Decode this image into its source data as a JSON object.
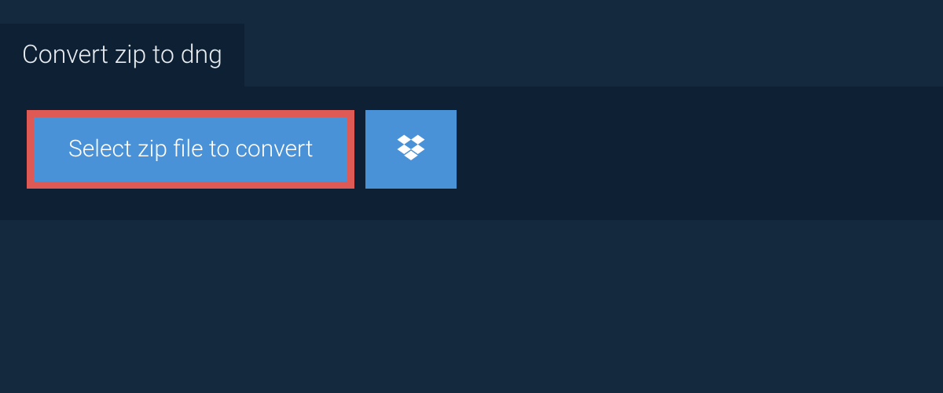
{
  "tab": {
    "title": "Convert zip to dng"
  },
  "main": {
    "select_button_label": "Select zip file to convert"
  }
}
